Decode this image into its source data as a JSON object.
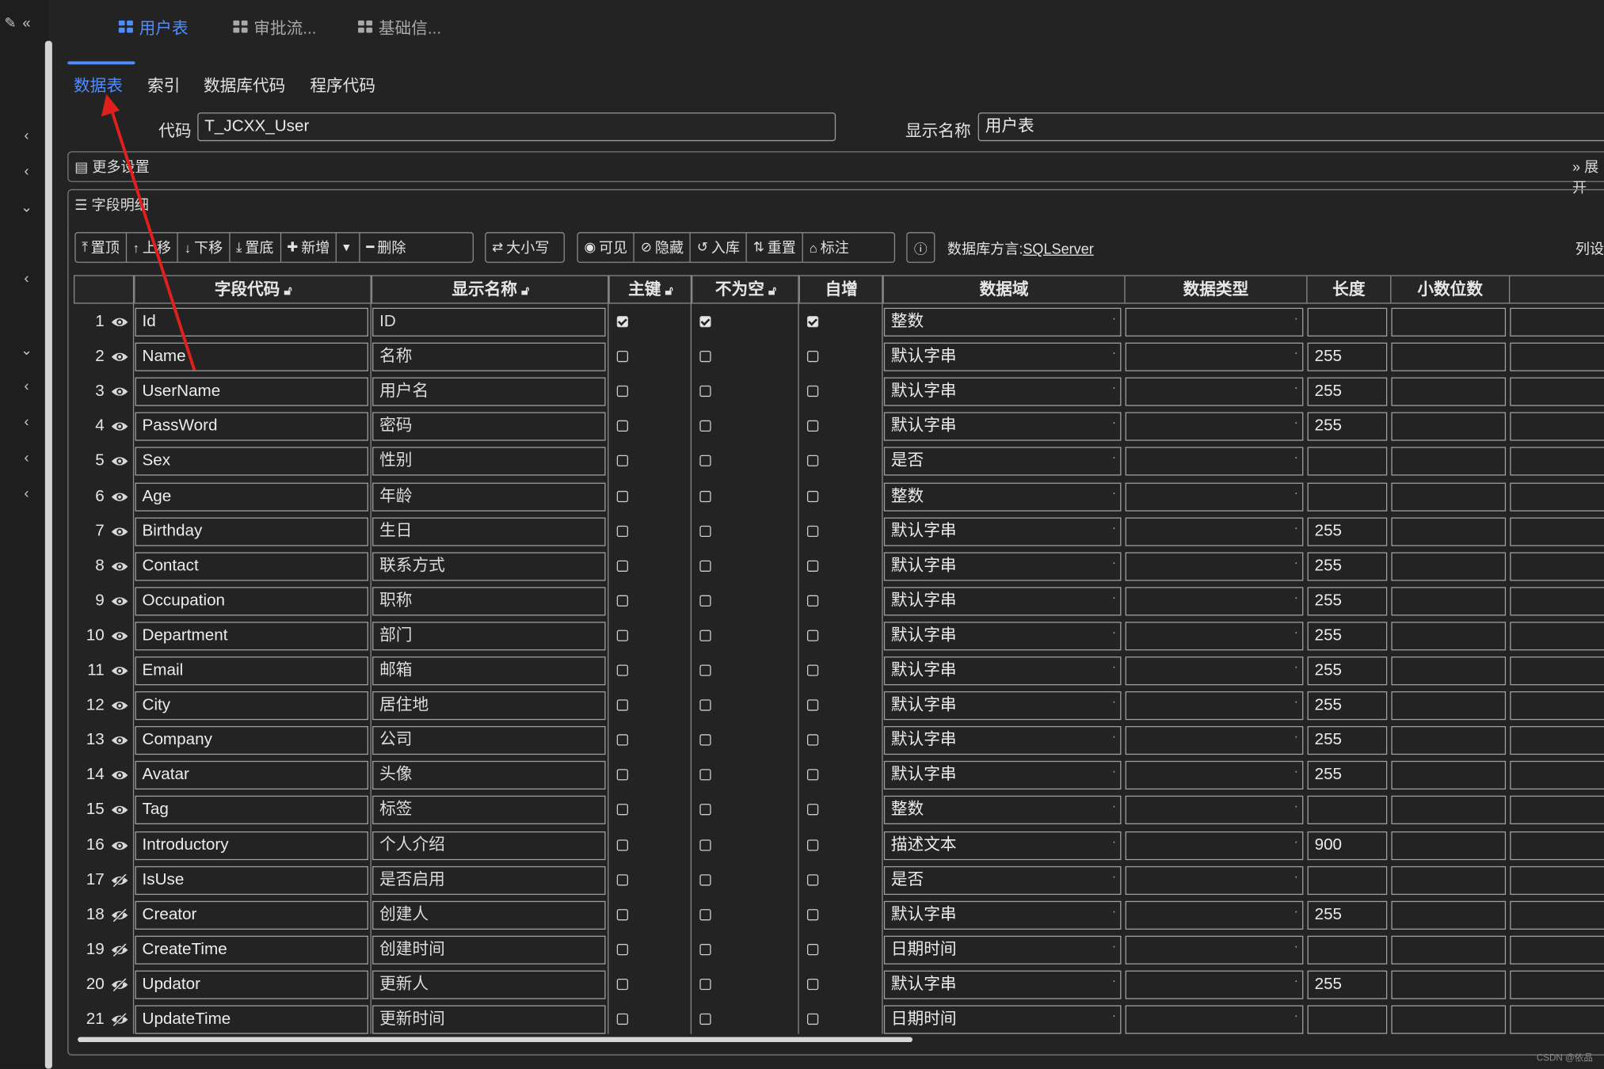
{
  "top_tabs": [
    {
      "label": "用户表",
      "active": true
    },
    {
      "label": "审批流...",
      "active": false
    },
    {
      "label": "基础信...",
      "active": false
    }
  ],
  "sub_tabs": [
    {
      "label": "数据表",
      "active": true
    },
    {
      "label": "索引",
      "active": false
    },
    {
      "label": "数据库代码",
      "active": false
    },
    {
      "label": "程序代码",
      "active": false
    }
  ],
  "form": {
    "code_label": "代码",
    "code_value": "T_JCXX_User",
    "display_label": "显示名称",
    "display_value": "用户表"
  },
  "more_settings": {
    "title": "更多设置",
    "expand_label": "展开"
  },
  "fields_panel": {
    "title": "字段明细"
  },
  "toolbar": {
    "group1": [
      "置顶",
      "上移",
      "下移",
      "置底",
      "新增",
      "删除"
    ],
    "case_label": "大小写",
    "group3": [
      "可见",
      "隐藏",
      "入库",
      "重置",
      "标注"
    ],
    "dialect_prefix": "数据库方言:",
    "dialect_value": "SQLServer",
    "col_settings": "列设"
  },
  "columns": [
    "字段代码",
    "显示名称",
    "主键",
    "不为空",
    "自增",
    "数据域",
    "数据类型",
    "长度",
    "小数位数"
  ],
  "rows": [
    {
      "n": "1",
      "visible": true,
      "code": "Id",
      "name": "ID",
      "pk": true,
      "notnull": true,
      "auto": true,
      "domain": "整数",
      "type": "",
      "length": "",
      "scale": ""
    },
    {
      "n": "2",
      "visible": true,
      "code": "Name",
      "name": "名称",
      "pk": false,
      "notnull": false,
      "auto": false,
      "domain": "默认字串",
      "type": "",
      "length": "255",
      "scale": ""
    },
    {
      "n": "3",
      "visible": true,
      "code": "UserName",
      "name": "用户名",
      "pk": false,
      "notnull": false,
      "auto": false,
      "domain": "默认字串",
      "type": "",
      "length": "255",
      "scale": ""
    },
    {
      "n": "4",
      "visible": true,
      "code": "PassWord",
      "name": "密码",
      "pk": false,
      "notnull": false,
      "auto": false,
      "domain": "默认字串",
      "type": "",
      "length": "255",
      "scale": ""
    },
    {
      "n": "5",
      "visible": true,
      "code": "Sex",
      "name": "性别",
      "pk": false,
      "notnull": false,
      "auto": false,
      "domain": "是否",
      "type": "",
      "length": "",
      "scale": ""
    },
    {
      "n": "6",
      "visible": true,
      "code": "Age",
      "name": "年龄",
      "pk": false,
      "notnull": false,
      "auto": false,
      "domain": "整数",
      "type": "",
      "length": "",
      "scale": ""
    },
    {
      "n": "7",
      "visible": true,
      "code": "Birthday",
      "name": "生日",
      "pk": false,
      "notnull": false,
      "auto": false,
      "domain": "默认字串",
      "type": "",
      "length": "255",
      "scale": ""
    },
    {
      "n": "8",
      "visible": true,
      "code": "Contact",
      "name": "联系方式",
      "pk": false,
      "notnull": false,
      "auto": false,
      "domain": "默认字串",
      "type": "",
      "length": "255",
      "scale": ""
    },
    {
      "n": "9",
      "visible": true,
      "code": "Occupation",
      "name": "职称",
      "pk": false,
      "notnull": false,
      "auto": false,
      "domain": "默认字串",
      "type": "",
      "length": "255",
      "scale": ""
    },
    {
      "n": "10",
      "visible": true,
      "code": "Department",
      "name": "部门",
      "pk": false,
      "notnull": false,
      "auto": false,
      "domain": "默认字串",
      "type": "",
      "length": "255",
      "scale": ""
    },
    {
      "n": "11",
      "visible": true,
      "code": "Email",
      "name": "邮箱",
      "pk": false,
      "notnull": false,
      "auto": false,
      "domain": "默认字串",
      "type": "",
      "length": "255",
      "scale": ""
    },
    {
      "n": "12",
      "visible": true,
      "code": "City",
      "name": "居住地",
      "pk": false,
      "notnull": false,
      "auto": false,
      "domain": "默认字串",
      "type": "",
      "length": "255",
      "scale": ""
    },
    {
      "n": "13",
      "visible": true,
      "code": "Company",
      "name": "公司",
      "pk": false,
      "notnull": false,
      "auto": false,
      "domain": "默认字串",
      "type": "",
      "length": "255",
      "scale": ""
    },
    {
      "n": "14",
      "visible": true,
      "code": "Avatar",
      "name": "头像",
      "pk": false,
      "notnull": false,
      "auto": false,
      "domain": "默认字串",
      "type": "",
      "length": "255",
      "scale": ""
    },
    {
      "n": "15",
      "visible": true,
      "code": "Tag",
      "name": "标签",
      "pk": false,
      "notnull": false,
      "auto": false,
      "domain": "整数",
      "type": "",
      "length": "",
      "scale": ""
    },
    {
      "n": "16",
      "visible": true,
      "code": "Introductory",
      "name": "个人介绍",
      "pk": false,
      "notnull": false,
      "auto": false,
      "domain": "描述文本",
      "type": "",
      "length": "900",
      "scale": ""
    },
    {
      "n": "17",
      "visible": false,
      "code": "IsUse",
      "name": "是否启用",
      "pk": false,
      "notnull": false,
      "auto": false,
      "domain": "是否",
      "type": "",
      "length": "",
      "scale": ""
    },
    {
      "n": "18",
      "visible": false,
      "code": "Creator",
      "name": "创建人",
      "pk": false,
      "notnull": false,
      "auto": false,
      "domain": "默认字串",
      "type": "",
      "length": "255",
      "scale": ""
    },
    {
      "n": "19",
      "visible": false,
      "code": "CreateTime",
      "name": "创建时间",
      "pk": false,
      "notnull": false,
      "auto": false,
      "domain": "日期时间",
      "type": "",
      "length": "",
      "scale": ""
    },
    {
      "n": "20",
      "visible": false,
      "code": "Updator",
      "name": "更新人",
      "pk": false,
      "notnull": false,
      "auto": false,
      "domain": "默认字串",
      "type": "",
      "length": "255",
      "scale": ""
    },
    {
      "n": "21",
      "visible": false,
      "code": "UpdateTime",
      "name": "更新时间",
      "pk": false,
      "notnull": false,
      "auto": false,
      "domain": "日期时间",
      "type": "",
      "length": "",
      "scale": ""
    }
  ],
  "watermark": "CSDN @依品",
  "colors": {
    "accent": "#4e8cff",
    "annotation_arrow": "#e0201c",
    "background": "#232323"
  }
}
